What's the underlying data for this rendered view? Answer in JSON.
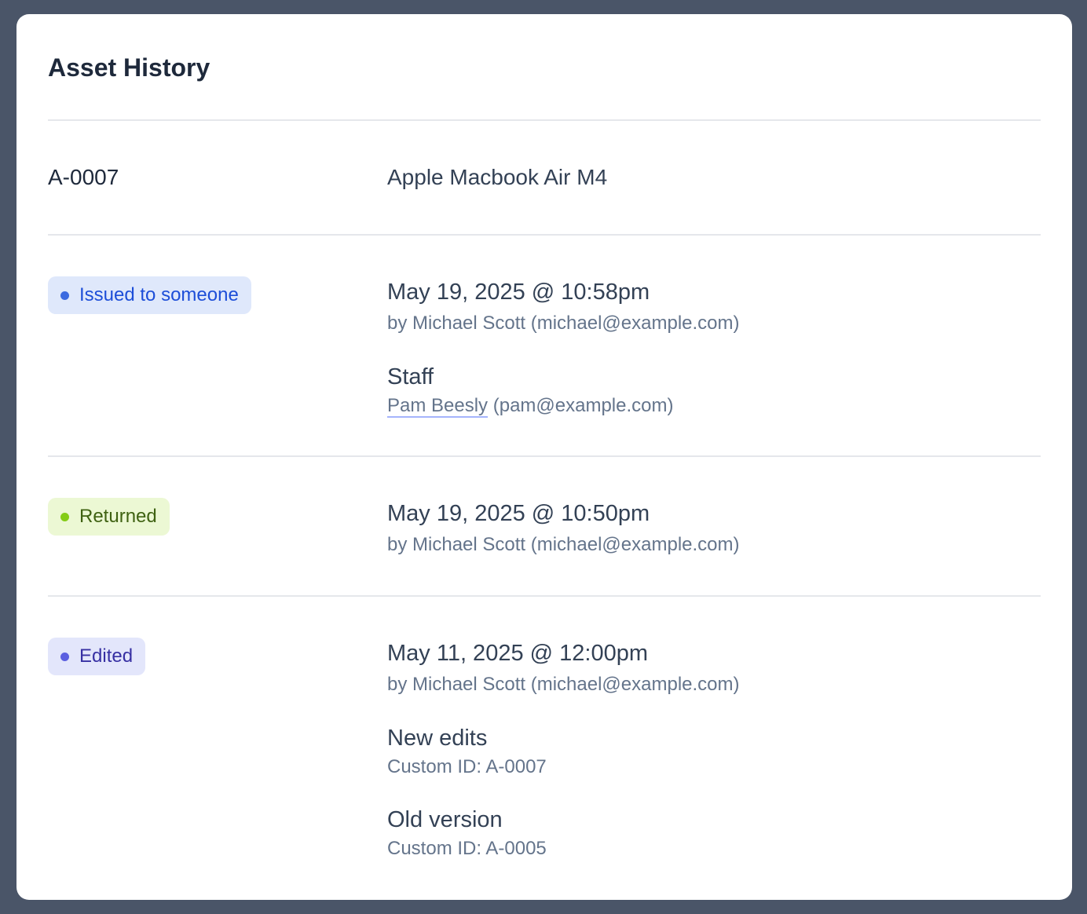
{
  "title": "Asset History",
  "asset": {
    "id": "A-0007",
    "name": "Apple Macbook Air M4"
  },
  "events": [
    {
      "status": "Issued to someone",
      "badge_bg": "#dfe8fb",
      "badge_fg": "#1d4ed8",
      "dot": "#3b6ae0",
      "timestamp": "May 19, 2025 @ 10:58pm",
      "by": "by Michael Scott (michael@example.com)",
      "staff_label": "Staff",
      "staff_name": "Pam Beesly",
      "staff_email": " (pam@example.com)"
    },
    {
      "status": "Returned",
      "badge_bg": "#ecf8d4",
      "badge_fg": "#3f6212",
      "dot": "#84cc16",
      "timestamp": "May 19, 2025 @ 10:50pm",
      "by": "by Michael Scott (michael@example.com)"
    },
    {
      "status": "Edited",
      "badge_bg": "#e3e6fb",
      "badge_fg": "#3730a3",
      "dot": "#5b5fe0",
      "timestamp": "May 11, 2025 @ 12:00pm",
      "by": "by Michael Scott (michael@example.com)",
      "new_label": "New edits",
      "new_value": "Custom ID: A-0007",
      "old_label": "Old version",
      "old_value": "Custom ID: A-0005"
    }
  ]
}
